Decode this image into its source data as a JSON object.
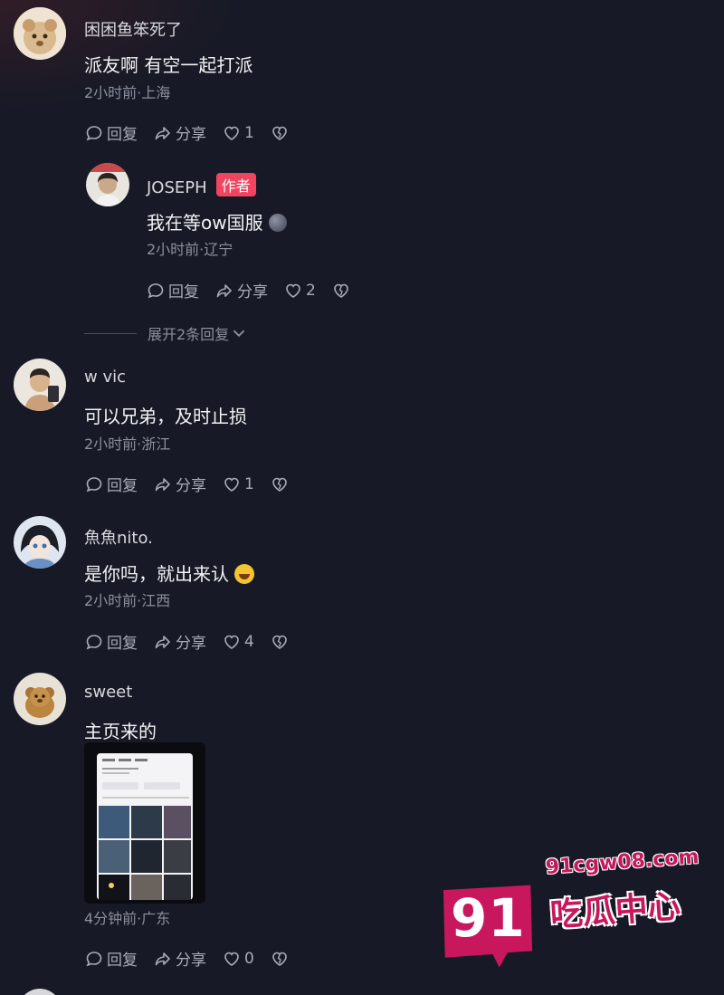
{
  "comments": [
    {
      "username": "困困鱼笨死了",
      "text": "派友啊 有空一起打派",
      "meta": "2小时前·上海",
      "reply_label": "回复",
      "share_label": "分享",
      "likes": "1"
    },
    {
      "username": "JOSEPH",
      "badge": "作者",
      "text": "我在等ow国服",
      "meta": "2小时前·辽宁",
      "reply_label": "回复",
      "share_label": "分享",
      "likes": "2"
    },
    {
      "username": "w vic",
      "text": "可以兄弟，及时止损",
      "meta": "2小时前·浙江",
      "reply_label": "回复",
      "share_label": "分享",
      "likes": "1"
    },
    {
      "username": "魚魚nito.",
      "text": "是你吗，就出来认",
      "meta": "2小时前·江西",
      "reply_label": "回复",
      "share_label": "分享",
      "likes": "4"
    },
    {
      "username": "sweet",
      "text": "主页来的",
      "meta": "4分钟前·广东",
      "reply_label": "回复",
      "share_label": "分享",
      "likes": "0"
    }
  ],
  "expand_replies_label": "展开2条回复",
  "watermark": {
    "number": "91",
    "domain": "91cgw08.com",
    "name": "吃瓜中心"
  },
  "colors": {
    "background": "#171a26",
    "author_badge": "#f0445f",
    "watermark": "#c8175d"
  },
  "icons": [
    "comment-bubble-icon",
    "share-arrow-icon",
    "heart-icon",
    "broken-heart-icon",
    "chevron-down-icon"
  ]
}
